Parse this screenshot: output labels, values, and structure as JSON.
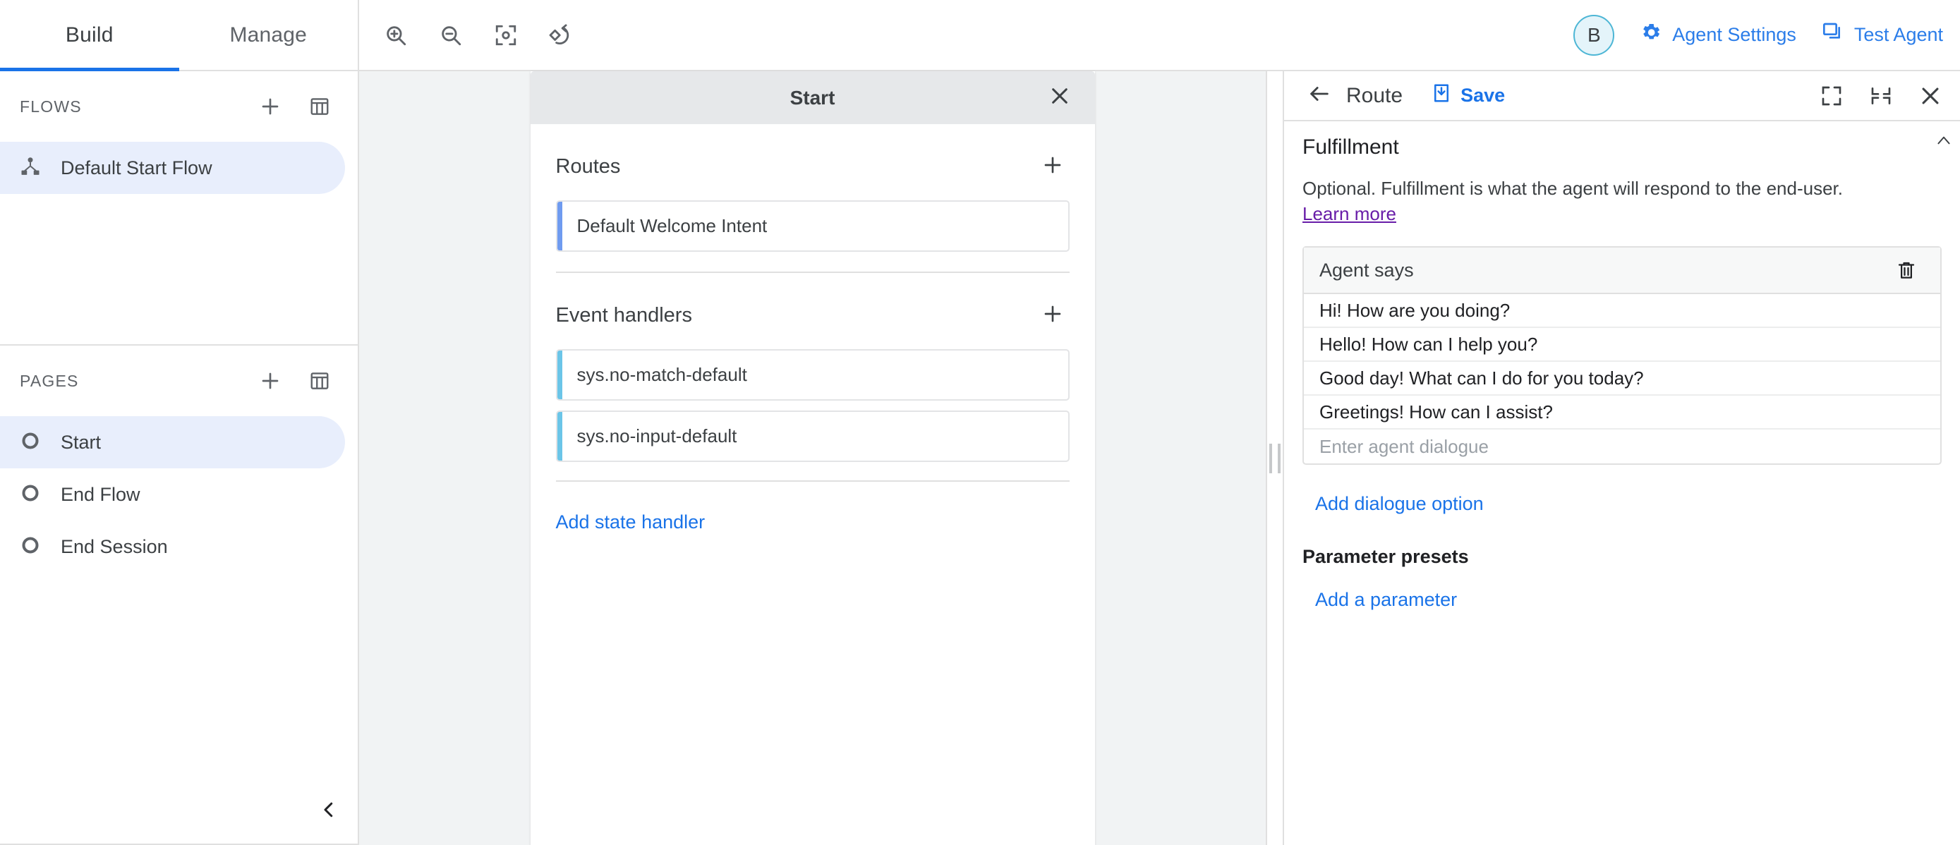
{
  "topbar": {
    "tabs": [
      {
        "label": "Build",
        "active": true
      },
      {
        "label": "Manage",
        "active": false
      }
    ],
    "tools": [
      {
        "name": "zoom-in-icon",
        "title": "Zoom in"
      },
      {
        "name": "zoom-out-icon",
        "title": "Zoom out"
      },
      {
        "name": "fit-to-screen-icon",
        "title": "Fit to screen"
      },
      {
        "name": "reset-layout-icon",
        "title": "Reset layout"
      }
    ],
    "avatar_initial": "B",
    "agent_settings_label": "Agent Settings",
    "test_agent_label": "Test Agent",
    "accent_blue": "#2b7de9"
  },
  "sidebar": {
    "flows": {
      "title": "FLOWS",
      "items": [
        {
          "label": "Default Start Flow",
          "selected": true,
          "icon": "flow-icon"
        }
      ]
    },
    "pages": {
      "title": "PAGES",
      "items": [
        {
          "label": "Start",
          "selected": true,
          "icon": "page-circle-icon"
        },
        {
          "label": "End Flow",
          "selected": false,
          "icon": "page-circle-icon"
        },
        {
          "label": "End Session",
          "selected": false,
          "icon": "page-circle-icon"
        }
      ]
    },
    "collapse_icon": "chevron-left-icon"
  },
  "node": {
    "title": "Start",
    "close_icon": "close-icon",
    "routes": {
      "title": "Routes",
      "add_icon": "plus-icon",
      "items": [
        {
          "label": "Default Welcome Intent",
          "kind": "intent",
          "accent": "#6f9bf0"
        }
      ]
    },
    "event_handlers": {
      "title": "Event handlers",
      "add_icon": "plus-icon",
      "items": [
        {
          "label": "sys.no-match-default",
          "kind": "event",
          "accent": "#6bc5e8"
        },
        {
          "label": "sys.no-input-default",
          "kind": "event",
          "accent": "#6bc5e8"
        }
      ]
    },
    "add_state_handler_label": "Add state handler"
  },
  "right_panel": {
    "back_icon": "arrow-left-icon",
    "title": "Route",
    "save_label": "Save",
    "save_icon": "save-icon",
    "header_icons": [
      {
        "name": "expand-icon"
      },
      {
        "name": "collapse-icon"
      },
      {
        "name": "close-icon"
      }
    ],
    "fulfillment": {
      "title": "Fulfillment",
      "description": "Optional. Fulfillment is what the agent will respond to the end-user.",
      "learn_more_label": "Learn more",
      "learn_more_color": "#681da8",
      "collapse_caret": "chevron-up-icon"
    },
    "agent_says": {
      "title": "Agent says",
      "delete_icon": "trash-icon",
      "dialogues": [
        "Hi! How are you doing?",
        "Hello! How can I help you?",
        "Good day! What can I do for you today?",
        "Greetings! How can I assist?"
      ],
      "new_dialogue_placeholder": "Enter agent dialogue"
    },
    "add_dialogue_option_label": "Add dialogue option",
    "parameter_presets_title": "Parameter presets",
    "add_parameter_label": "Add a parameter"
  }
}
